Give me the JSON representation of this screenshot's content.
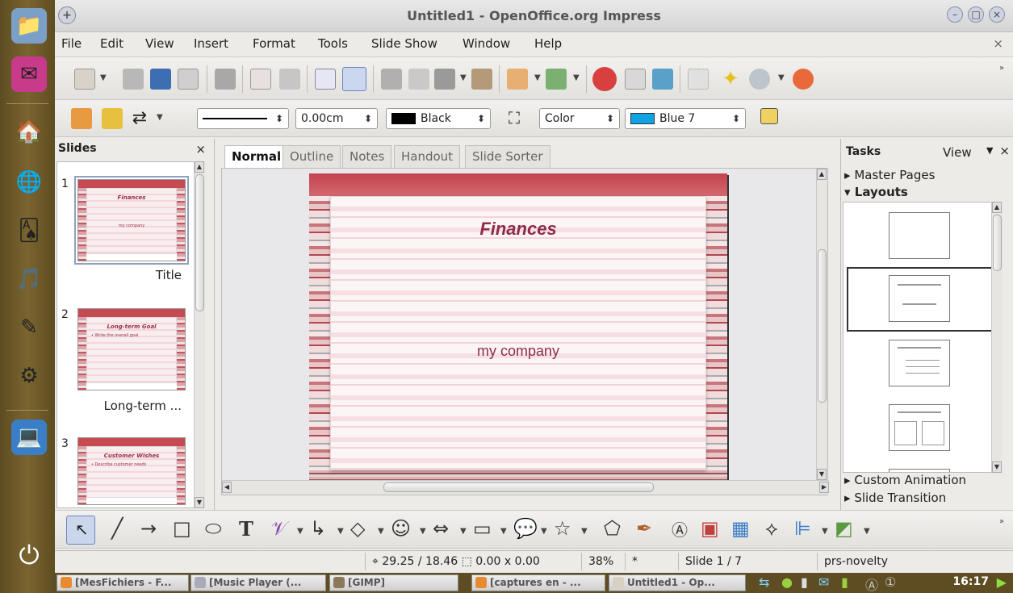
{
  "window": {
    "title": "Untitled1 - OpenOffice.org Impress"
  },
  "menu": [
    "File",
    "Edit",
    "View",
    "Insert",
    "Format",
    "Tools",
    "Slide Show",
    "Window",
    "Help"
  ],
  "line_toolbar": {
    "width_value": "0.00cm",
    "line_color": "Black",
    "area_style": "Color",
    "area_color": "Blue 7",
    "colors": {
      "black": "#000000",
      "blue7": "#0fa3e6"
    }
  },
  "slides_panel": {
    "title": "Slides",
    "close": "×",
    "slides": [
      {
        "num": "1",
        "thumb_title": "Finances",
        "thumb_body": "my company",
        "label": "Title"
      },
      {
        "num": "2",
        "thumb_title": "Long-term Goal",
        "thumb_body": "• Write the overall goal",
        "label": "Long-term ..."
      },
      {
        "num": "3",
        "thumb_title": "Customer Wishes",
        "thumb_body": "• Describe customer needs",
        "label": ""
      }
    ]
  },
  "view_tabs": [
    "Normal",
    "Outline",
    "Notes",
    "Handout",
    "Slide Sorter"
  ],
  "slide": {
    "title": "Finances",
    "subtitle": "my company",
    "accent": "#8f2b4d"
  },
  "tasks_panel": {
    "title": "Tasks",
    "view_label": "View",
    "close": "×",
    "sections": {
      "master_pages": "Master Pages",
      "layouts": "Layouts",
      "custom_animation": "Custom Animation",
      "slide_transition": "Slide Transition"
    }
  },
  "status": {
    "position": "29.25 / 18.46",
    "size": "0.00 x 0.00",
    "zoom": "38%",
    "modified": "*",
    "slide": "Slide 1 / 7",
    "master": "prs-novelty"
  },
  "taskbar": {
    "items": [
      "[MesFichiers - F...",
      "[Music Player (...",
      "[GIMP]",
      "[captures en - ...",
      "Untitled1 - Op..."
    ],
    "clock": "16:17"
  }
}
